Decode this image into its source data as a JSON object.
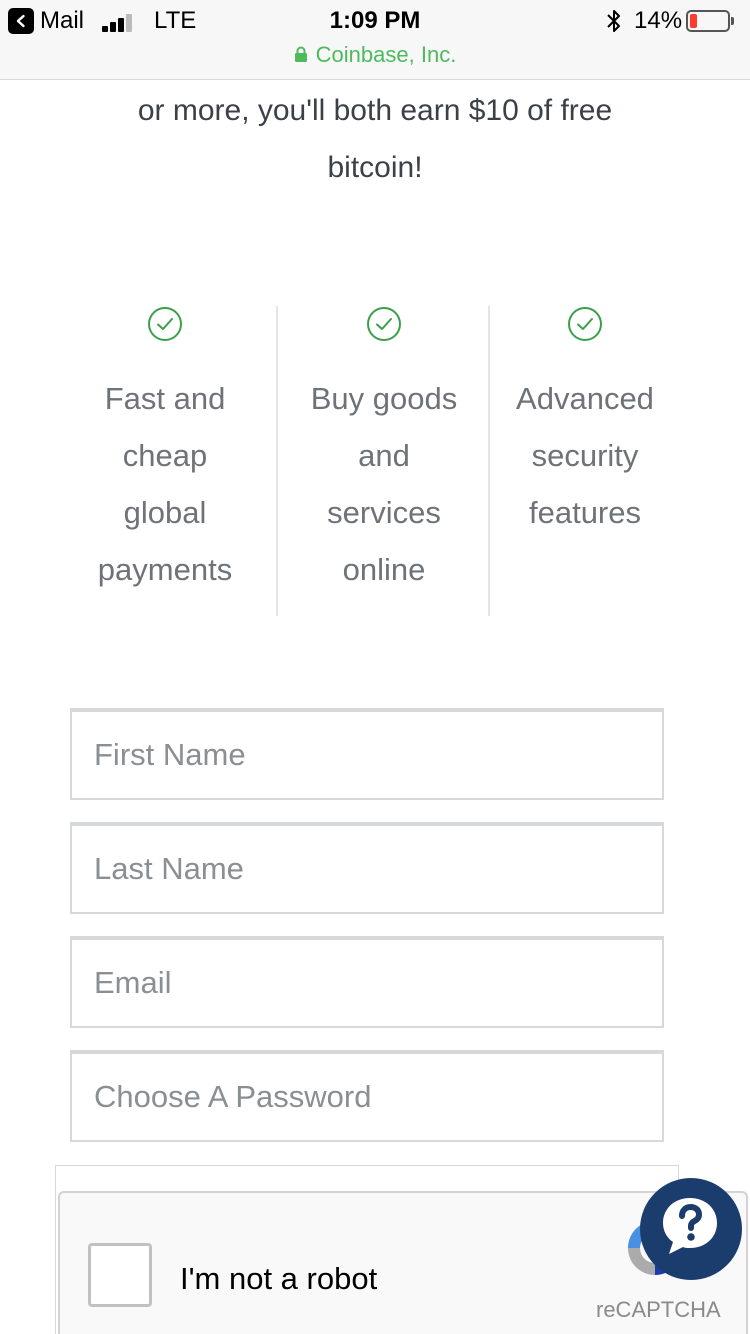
{
  "status_bar": {
    "back_label": "Mail",
    "carrier": "LTE",
    "time": "1:09 PM",
    "battery": "14%",
    "battery_level": 0.14,
    "site": "Coinbase, Inc."
  },
  "intro": {
    "line1": "or more, you'll both earn $10 of free",
    "line2": "bitcoin!"
  },
  "features": [
    {
      "lines": [
        "Fast and",
        "cheap",
        "global",
        "payments"
      ]
    },
    {
      "lines": [
        "Buy goods",
        "and",
        "services",
        "online"
      ]
    },
    {
      "lines": [
        "Advanced",
        "security",
        "features"
      ]
    }
  ],
  "form": {
    "first_name_placeholder": "First Name",
    "last_name_placeholder": "Last Name",
    "email_placeholder": "Email",
    "password_placeholder": "Choose A Password"
  },
  "captcha": {
    "label": "I'm not a robot",
    "brand": "reCAPTCHA"
  },
  "colors": {
    "accent_green": "#4cba5d",
    "check_green": "#3a9f4a",
    "help_navy": "#1b3d6e",
    "battery_red": "#ff3b30"
  },
  "icons": {
    "back": "back-arrow-icon",
    "lock": "lock-icon",
    "bluetooth": "bluetooth-icon",
    "check": "check-circle-icon",
    "help": "help-chat-icon",
    "recaptcha": "recaptcha-logo-icon"
  }
}
